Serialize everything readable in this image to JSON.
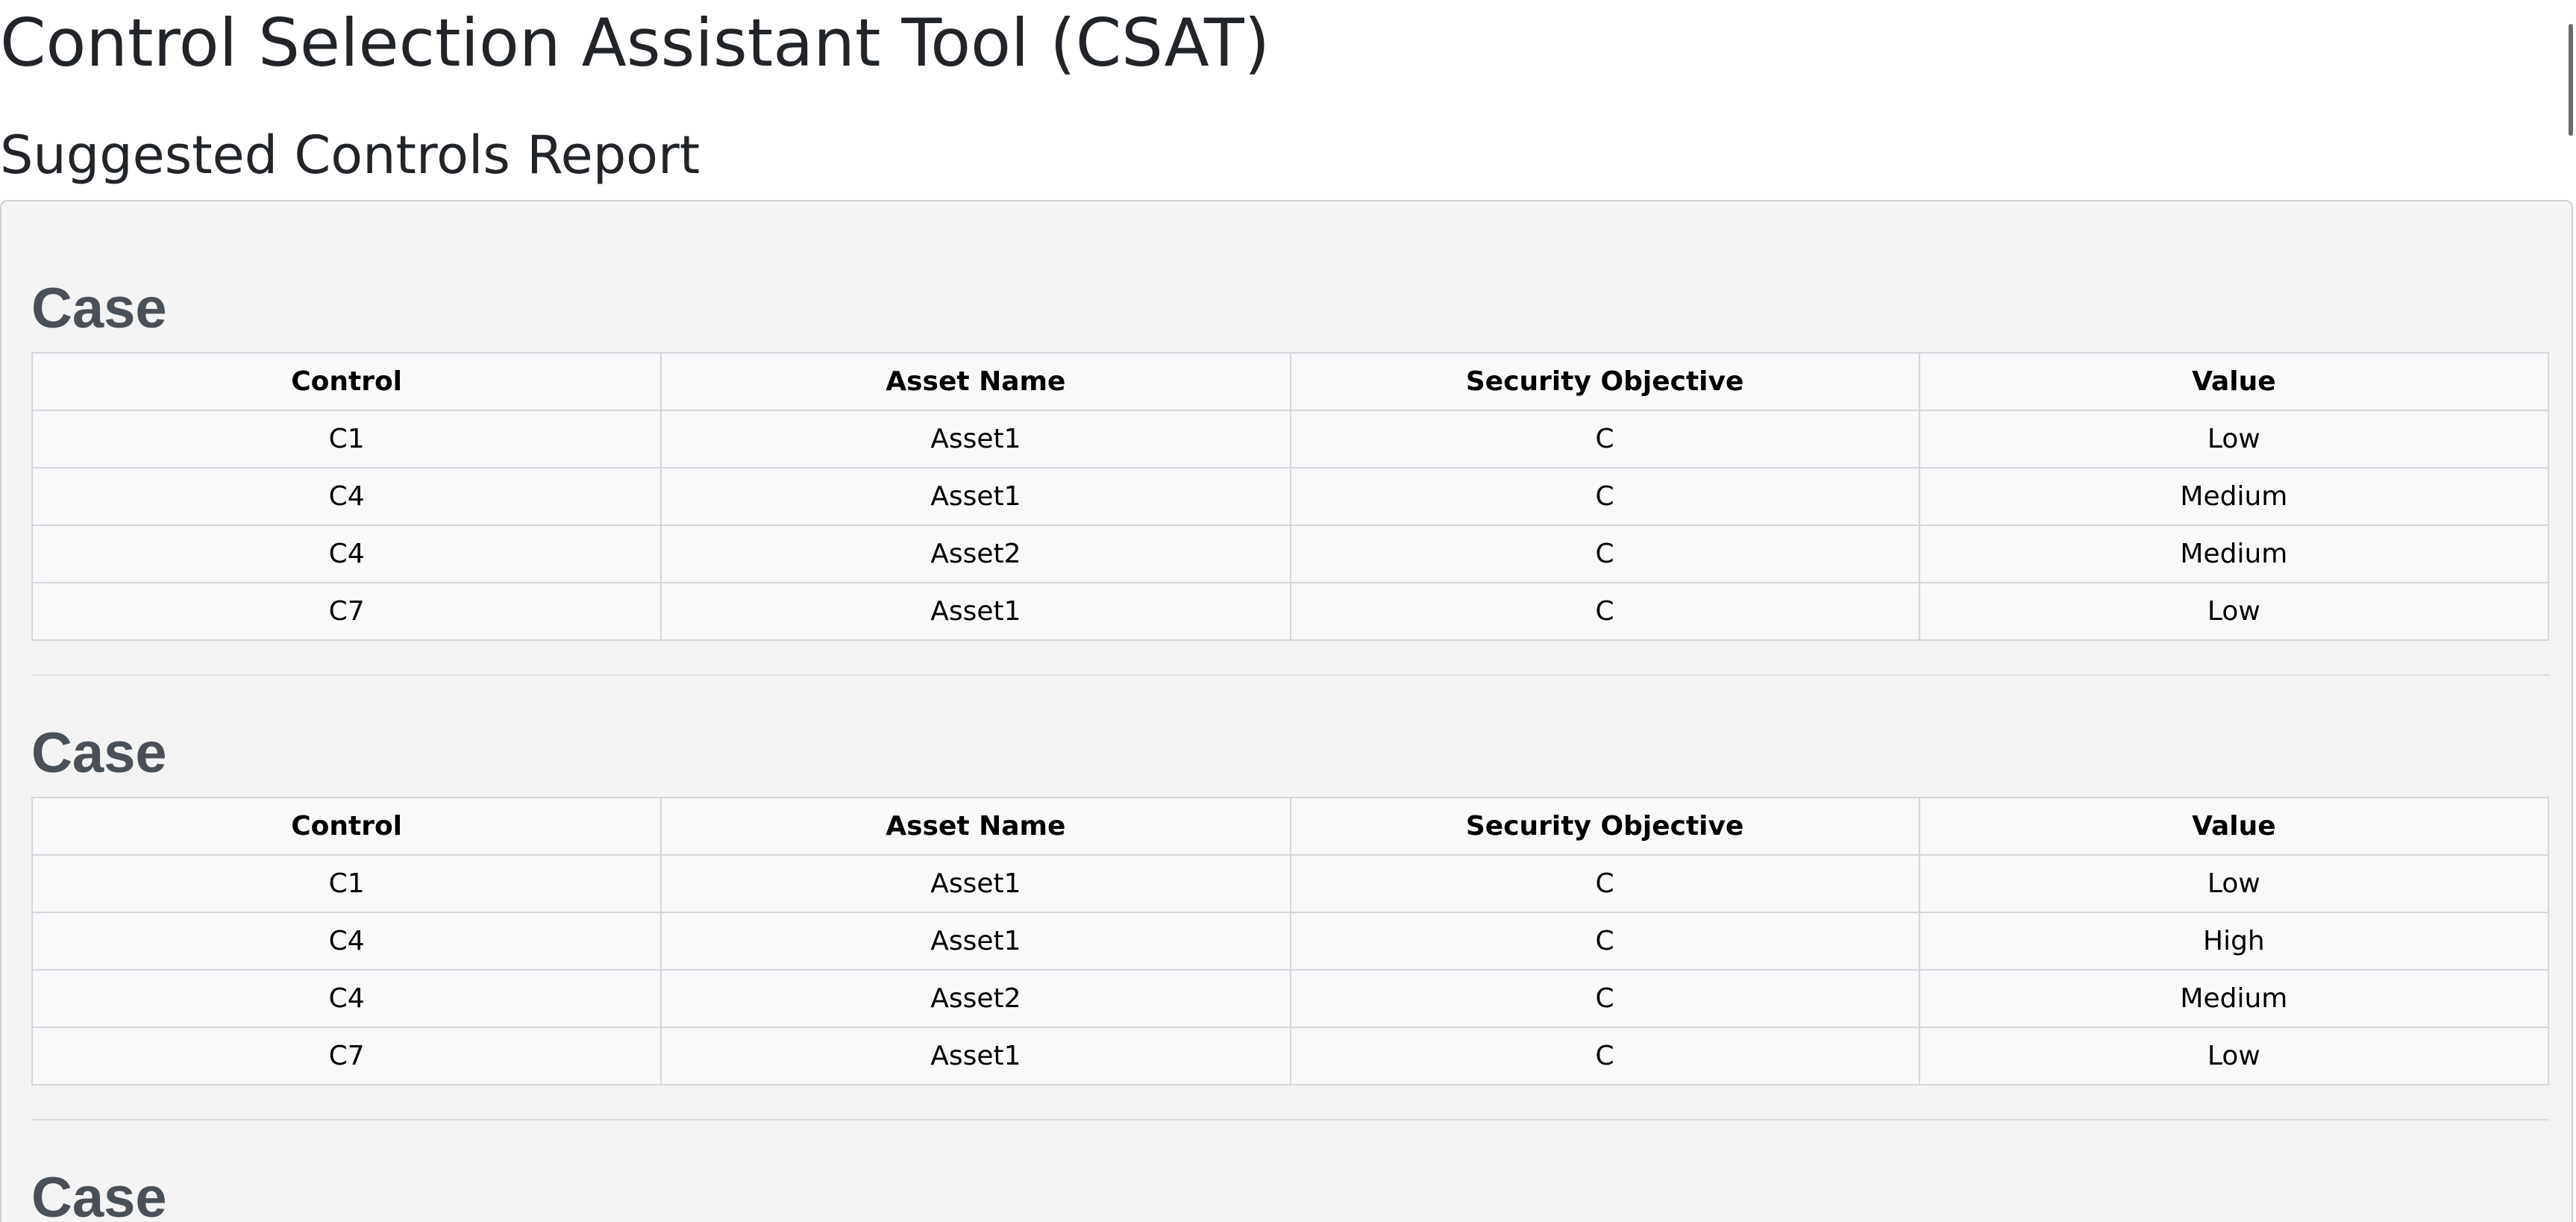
{
  "header": {
    "app_title": "Control Selection Assistant Tool (CSAT)",
    "report_title": "Suggested Controls Report"
  },
  "table_columns": [
    "Control",
    "Asset Name",
    "Security Objective",
    "Value"
  ],
  "cases": [
    {
      "heading": "Case",
      "rows": [
        [
          "C1",
          "Asset1",
          "C",
          "Low"
        ],
        [
          "C4",
          "Asset1",
          "C",
          "Medium"
        ],
        [
          "C4",
          "Asset2",
          "C",
          "Medium"
        ],
        [
          "C7",
          "Asset1",
          "C",
          "Low"
        ]
      ]
    },
    {
      "heading": "Case",
      "rows": [
        [
          "C1",
          "Asset1",
          "C",
          "Low"
        ],
        [
          "C4",
          "Asset1",
          "C",
          "High"
        ],
        [
          "C4",
          "Asset2",
          "C",
          "Medium"
        ],
        [
          "C7",
          "Asset1",
          "C",
          "Low"
        ]
      ]
    },
    {
      "heading": "Case",
      "rows": []
    }
  ],
  "colors": {
    "panel_background": "#f4f4f4",
    "heading_text": "#495057",
    "table_border": "#d5d7da"
  }
}
